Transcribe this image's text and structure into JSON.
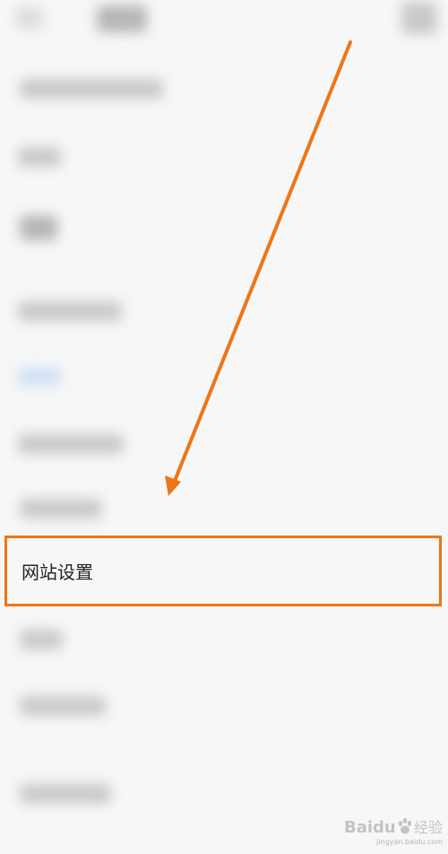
{
  "settings_item": {
    "label": "网站设置"
  },
  "watermark": {
    "brand": "Baidu",
    "cn": "经验",
    "url": "jingyan.baidu.com"
  },
  "colors": {
    "highlight": "#f07516",
    "arrow": "#f07516"
  },
  "icons": {
    "back": "back-arrow-icon",
    "more": "more-icon"
  }
}
